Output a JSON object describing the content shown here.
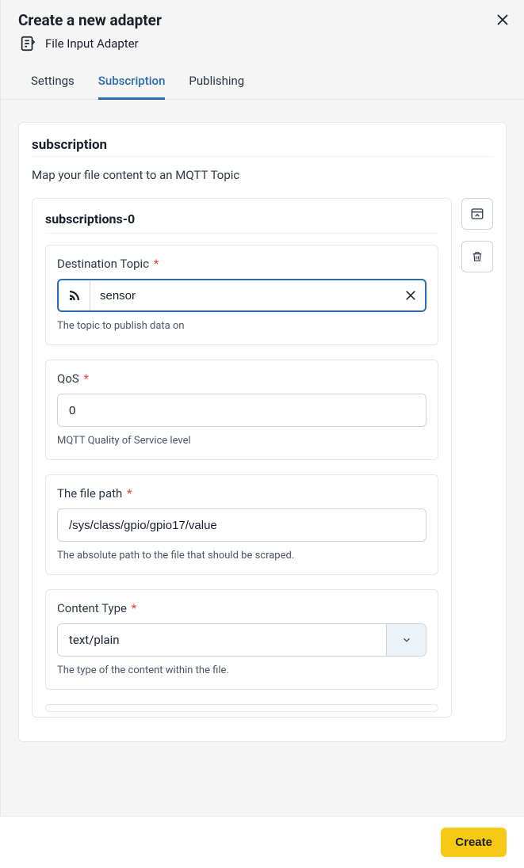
{
  "header": {
    "title": "Create a new adapter",
    "subtitle": "File Input Adapter"
  },
  "tabs": [
    {
      "label": "Settings",
      "active": false
    },
    {
      "label": "Subscription",
      "active": true
    },
    {
      "label": "Publishing",
      "active": false
    }
  ],
  "section": {
    "title": "subscription",
    "description": "Map your file content to an MQTT Topic"
  },
  "subscription": {
    "item_title": "subscriptions-0",
    "fields": {
      "destination_topic": {
        "label": "Destination Topic",
        "value": "sensor",
        "help": "The topic to publish data on"
      },
      "qos": {
        "label": "QoS",
        "value": "0",
        "help": "MQTT Quality of Service level"
      },
      "file_path": {
        "label": "The file path",
        "value": "/sys/class/gpio/gpio17/value",
        "help": "The absolute path to the file that should be scraped."
      },
      "content_type": {
        "label": "Content Type",
        "value": "text/plain",
        "help": "The type of the content within the file."
      }
    }
  },
  "footer": {
    "create_label": "Create"
  },
  "required_marker": "*"
}
